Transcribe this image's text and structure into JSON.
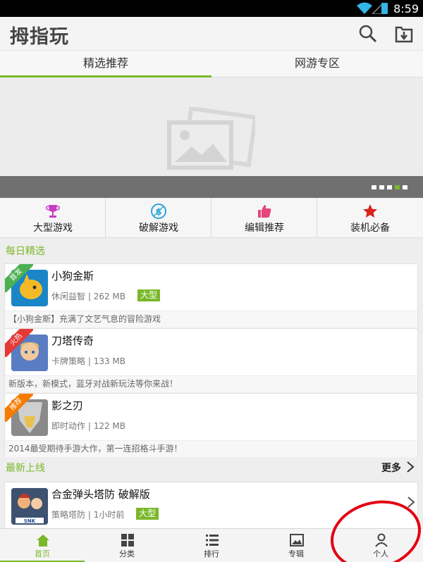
{
  "statusbar": {
    "time": "8:59"
  },
  "appbar": {
    "title": "拇指玩"
  },
  "tabs": [
    {
      "label": "精选推荐",
      "active": true
    },
    {
      "label": "网游专区",
      "active": false
    }
  ],
  "banner": {
    "page_count": 5,
    "active_page": 4
  },
  "categories": [
    {
      "label": "大型游戏",
      "icon": "trophy-icon"
    },
    {
      "label": "破解游戏",
      "icon": "crack-icon"
    },
    {
      "label": "编辑推荐",
      "icon": "thumbs-up-icon"
    },
    {
      "label": "装机必备",
      "icon": "star-icon"
    }
  ],
  "daily": {
    "title": "每日精选",
    "apps": [
      {
        "ribbon": "首发",
        "ribbon_color": "#4caf50",
        "name": "小狗金斯",
        "category": "休闲益智",
        "size": "262 MB",
        "tag": "大型",
        "desc": "【小狗金斯】充满了文艺气息的冒险游戏"
      },
      {
        "ribbon": "火热",
        "ribbon_color": "#e53935",
        "name": "刀塔传奇",
        "category": "卡牌策略",
        "size": "133 MB",
        "tag": "",
        "desc": "新版本，新模式，蓝牙对战新玩法等你来战！"
      },
      {
        "ribbon": "推荐",
        "ribbon_color": "#f57c00",
        "name": "影之刃",
        "category": "即时动作",
        "size": "122 MB",
        "tag": "",
        "desc": "2014最受期待手游大作，第一连招格斗手游！"
      }
    ]
  },
  "latest": {
    "title": "最新上线",
    "more": "更多",
    "apps": [
      {
        "name": "合金弹头塔防 破解版",
        "category": "策略塔防",
        "time": "1小时前",
        "tag": "大型"
      }
    ]
  },
  "bottomnav": [
    {
      "label": "首页",
      "icon": "home-icon",
      "active": true
    },
    {
      "label": "分类",
      "icon": "grid-icon",
      "active": false
    },
    {
      "label": "排行",
      "icon": "list-icon",
      "active": false
    },
    {
      "label": "专辑",
      "icon": "image-icon",
      "active": false
    },
    {
      "label": "个人",
      "icon": "person-icon",
      "active": false
    }
  ],
  "colors": {
    "accent": "#7ab829",
    "annotation": "#e30012"
  }
}
